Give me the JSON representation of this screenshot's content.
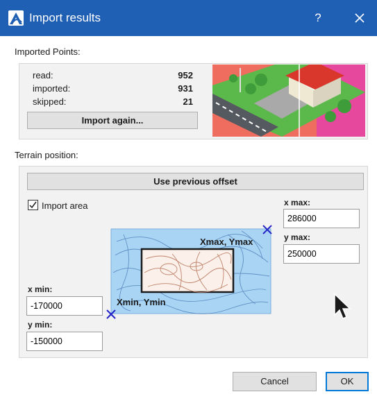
{
  "window": {
    "title": "Import results",
    "help_glyph": "?",
    "icon": "app-logo-icon",
    "close_icon": "close-icon",
    "accent_color": "#1f5fb4"
  },
  "imported_points": {
    "section_label": "Imported Points:",
    "stats": [
      {
        "label": "read:",
        "value": "952"
      },
      {
        "label": "imported:",
        "value": "931"
      },
      {
        "label": "skipped:",
        "value": "21"
      }
    ],
    "import_again_label": "Import again..."
  },
  "terrain": {
    "section_label": "Terrain position:",
    "use_previous_label": "Use previous offset",
    "import_area": {
      "label": "Import area",
      "checked": true
    },
    "map": {
      "max_label": "Xmax, Ymax",
      "min_label": "Xmin, Ymin"
    },
    "x_max": {
      "label": "x max:",
      "value": "286000"
    },
    "y_max": {
      "label": "y max:",
      "value": "250000"
    },
    "x_min": {
      "label": "x min:",
      "value": "-170000"
    },
    "y_min": {
      "label": "y min:",
      "value": "-150000"
    }
  },
  "buttons": {
    "cancel_label": "Cancel",
    "ok_label": "OK"
  }
}
